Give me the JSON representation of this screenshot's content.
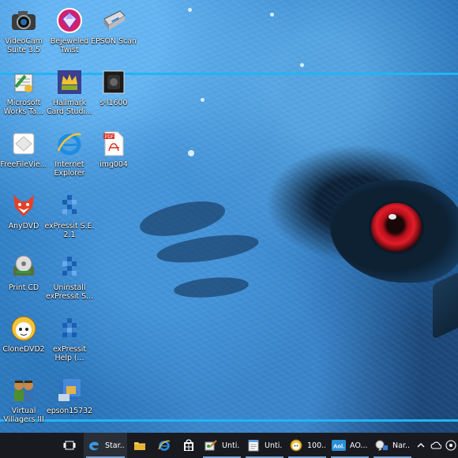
{
  "desktop": {
    "icons": [
      {
        "label": "VideoCam\nSuite 3.5",
        "icon": "videocam-icon"
      },
      {
        "label": "Bejeweled\nTwist",
        "icon": "bejeweled-icon"
      },
      {
        "label": "EPSON Scan",
        "icon": "scanner-icon"
      },
      {
        "label": "Microsoft\nWorks Ta...",
        "icon": "works-icon"
      },
      {
        "label": "Hallmark\nCard Studi...",
        "icon": "hallmark-icon"
      },
      {
        "label": "s-l1600",
        "icon": "image-file-icon"
      },
      {
        "label": "FreeFileVie...",
        "icon": "freefileviewer-icon"
      },
      {
        "label": "Internet\nExplorer",
        "icon": "internet-explorer-icon"
      },
      {
        "label": "img004",
        "icon": "pdf-file-icon"
      },
      {
        "label": "AnyDVD",
        "icon": "anydvd-fox-icon"
      },
      {
        "label": "exPressit S.E.\n2.1",
        "icon": "expressit-icon"
      },
      {
        "label": "Print CD",
        "icon": "printcd-icon"
      },
      {
        "label": "Uninstall\nexPressit S...",
        "icon": "expressit-uninstall-icon"
      },
      {
        "label": "CloneDVD2",
        "icon": "clonedvd-sheep-icon"
      },
      {
        "label": "exPressit\nHelp (...",
        "icon": "expressit-help-icon"
      },
      {
        "label": "Virtual\nVillagers III",
        "icon": "virtual-villagers-icon"
      },
      {
        "label": "epson15732",
        "icon": "epson-installer-icon"
      }
    ]
  },
  "taskbar": {
    "apps": [
      {
        "label": "",
        "icon": "task-view-icon"
      },
      {
        "label": "Star...",
        "icon": "edge-icon"
      },
      {
        "label": "",
        "icon": "file-explorer-icon"
      },
      {
        "label": "",
        "icon": "internet-explorer-icon"
      },
      {
        "label": "",
        "icon": "store-icon"
      },
      {
        "label": "Unti...",
        "icon": "paint-icon"
      },
      {
        "label": "Unti...",
        "icon": "notepad-icon"
      },
      {
        "label": "100...",
        "icon": "photo-viewer-icon"
      },
      {
        "label": "AO...",
        "icon": "aol-icon"
      },
      {
        "label": "Nar...",
        "icon": "narrator-icon"
      }
    ],
    "tray": [
      "chevron-up-icon",
      "onedrive-icon",
      "wifi-icon"
    ],
    "colors": {
      "taskbar": "#181a20",
      "accent_line": "#22b4f5"
    }
  }
}
